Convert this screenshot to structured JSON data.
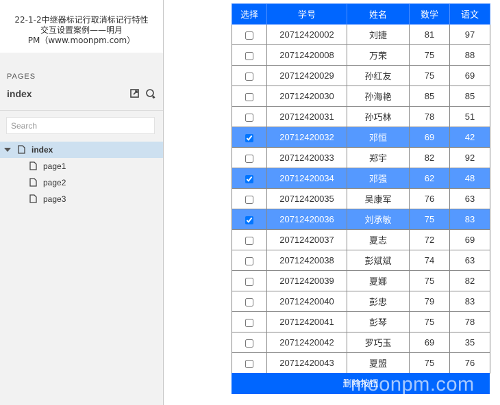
{
  "project": {
    "title_line1": "22-1-2中继器标记行取消标记行特性",
    "title_line2": "交互设置案例——明月",
    "title_line3": "PM（www.moonpm.com）"
  },
  "pages_panel": {
    "section_label": "PAGES",
    "current_page": "index",
    "search_placeholder": "Search",
    "tree": [
      {
        "label": "index"
      },
      {
        "label": "page1"
      },
      {
        "label": "page2"
      },
      {
        "label": "page3"
      }
    ]
  },
  "table": {
    "headers": [
      "选择",
      "学号",
      "姓名",
      "数学",
      "语文"
    ],
    "rows": [
      {
        "id": "20712420002",
        "name": "刘捷",
        "math": "81",
        "chinese": "97",
        "checked": false
      },
      {
        "id": "20712420008",
        "name": "万荣",
        "math": "75",
        "chinese": "88",
        "checked": false
      },
      {
        "id": "20712420029",
        "name": "孙红友",
        "math": "75",
        "chinese": "69",
        "checked": false
      },
      {
        "id": "20712420030",
        "name": "孙海艳",
        "math": "85",
        "chinese": "85",
        "checked": false
      },
      {
        "id": "20712420031",
        "name": "孙巧林",
        "math": "78",
        "chinese": "51",
        "checked": false
      },
      {
        "id": "20712420032",
        "name": "邓恒",
        "math": "69",
        "chinese": "42",
        "checked": true
      },
      {
        "id": "20712420033",
        "name": "郑宇",
        "math": "82",
        "chinese": "92",
        "checked": false
      },
      {
        "id": "20712420034",
        "name": "邓强",
        "math": "62",
        "chinese": "48",
        "checked": true
      },
      {
        "id": "20712420035",
        "name": "吴康军",
        "math": "76",
        "chinese": "63",
        "checked": false
      },
      {
        "id": "20712420036",
        "name": "刘承敏",
        "math": "75",
        "chinese": "83",
        "checked": true
      },
      {
        "id": "20712420037",
        "name": "夏志",
        "math": "72",
        "chinese": "69",
        "checked": false
      },
      {
        "id": "20712420038",
        "name": "彭斌斌",
        "math": "74",
        "chinese": "63",
        "checked": false
      },
      {
        "id": "20712420039",
        "name": "夏娜",
        "math": "75",
        "chinese": "82",
        "checked": false
      },
      {
        "id": "20712420040",
        "name": "彭忠",
        "math": "79",
        "chinese": "83",
        "checked": false
      },
      {
        "id": "20712420041",
        "name": "彭琴",
        "math": "75",
        "chinese": "78",
        "checked": false
      },
      {
        "id": "20712420042",
        "name": "罗巧玉",
        "math": "69",
        "chinese": "35",
        "checked": false
      },
      {
        "id": "20712420043",
        "name": "夏盟",
        "math": "75",
        "chinese": "76",
        "checked": false
      }
    ]
  },
  "delete_button_label": "删除按钮",
  "watermark": "moonpm.com",
  "colors": {
    "header_blue": "#0066ff",
    "checked_row_blue": "#5599ff",
    "selected_tree_item": "#cde0f0"
  }
}
